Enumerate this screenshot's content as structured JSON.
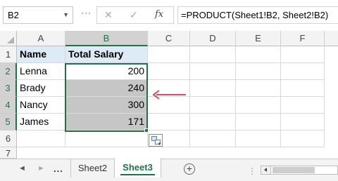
{
  "formula_bar": {
    "name_box": "B2",
    "cancel_glyph": "✕",
    "enter_glyph": "✓",
    "fx_label": "fx",
    "formula": "=PRODUCT(Sheet1!B2, Sheet2!B2)"
  },
  "columns": [
    "A",
    "B",
    "C",
    "D",
    "E",
    "F"
  ],
  "rows": [
    "1",
    "2",
    "3",
    "4",
    "5",
    "6",
    "7"
  ],
  "table": {
    "headers": [
      "Name",
      "Total Salary"
    ],
    "records": [
      {
        "name": "Lenna",
        "salary": "200"
      },
      {
        "name": "Brady",
        "salary": "240"
      },
      {
        "name": "Nancy",
        "salary": "300"
      },
      {
        "name": "James",
        "salary": "171"
      }
    ]
  },
  "tabs": {
    "more": "...",
    "items": [
      "Sheet2",
      "Sheet3"
    ],
    "active": "Sheet3",
    "add_glyph": "+"
  },
  "icons": {
    "name_box_dropdown": "chevron-down-icon",
    "cancel": "close-icon",
    "enter": "check-icon",
    "function": "fx-icon",
    "quick_analysis": "quick-analysis-icon",
    "annotation": "arrow-left-icon",
    "add_sheet": "plus-circle-icon"
  },
  "colors": {
    "excel_green": "#217346",
    "header_fill": "#ddebf7",
    "selection_fill": "#c6c6c6",
    "arrow": "#c9525c"
  }
}
